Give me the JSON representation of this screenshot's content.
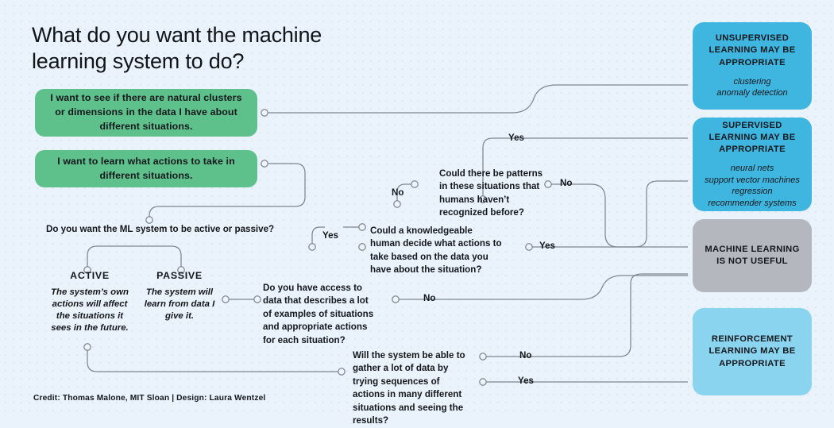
{
  "title": "What do you want the machine learning system to do?",
  "credit": "Credit: Thomas Malone, MIT Sloan | Design: Laura Wentzel",
  "colors": {
    "background": "#eaf2fb",
    "green": "#5ec18c",
    "blue_strong": "#3fb6e0",
    "blue_light": "#8ad4ef",
    "gray": "#b4b7bd",
    "wire": "#7e868f",
    "text": "#12181d"
  },
  "start_options": [
    {
      "id": "clusters",
      "text": "I want to see if there are natural clusters or dimensions in the data I have about different situations."
    },
    {
      "id": "actions",
      "text": "I want to learn what actions to take in different situations."
    }
  ],
  "questions": {
    "active_passive": "Do you want the ML system to be active or passive?",
    "patterns": "Could there be patterns in these situations that humans haven’t recognized before?",
    "knowledgeable_human": "Could a knowledgeable human decide what actions to take based on the data you have about the situation?",
    "data_access": "Do you have access to data that describes a lot of examples of situations and appropriate actions for each situation?",
    "gather_data": "Will the system be able to gather a lot of data by trying sequences of actions in many different situations and seeing the results?"
  },
  "modes": [
    {
      "id": "active",
      "head": "ACTIVE",
      "body": "The system’s own actions will affect the situations it sees in the future."
    },
    {
      "id": "passive",
      "head": "PASSIVE",
      "body": "The system will learn from data I give it."
    }
  ],
  "edge_labels": {
    "patterns_yes": "Yes",
    "patterns_no_left": "No",
    "patterns_no_right": "No",
    "knowledge_yes": "Yes",
    "access_yes": "Yes",
    "access_no": "No",
    "gather_no": "No",
    "gather_yes": "Yes"
  },
  "outcomes": [
    {
      "id": "unsupervised",
      "heading": "UNSUPERVISED LEARNING MAY BE APPROPRIATE",
      "examples": "clustering\nanomaly detection",
      "color": "#3fb6e0"
    },
    {
      "id": "supervised",
      "heading": "SUPERVISED LEARNING MAY BE APPROPRIATE",
      "examples": "neural nets\nsupport vector machines\nregression\nrecommender systems",
      "color": "#3fb6e0"
    },
    {
      "id": "not-useful",
      "heading": "MACHINE LEARNING IS NOT USEFUL",
      "examples": "",
      "color": "#b4b7bd"
    },
    {
      "id": "reinforcement",
      "heading": "REINFORCEMENT LEARNING MAY BE APPROPRIATE",
      "examples": "",
      "color": "#8ad4ef"
    }
  ]
}
